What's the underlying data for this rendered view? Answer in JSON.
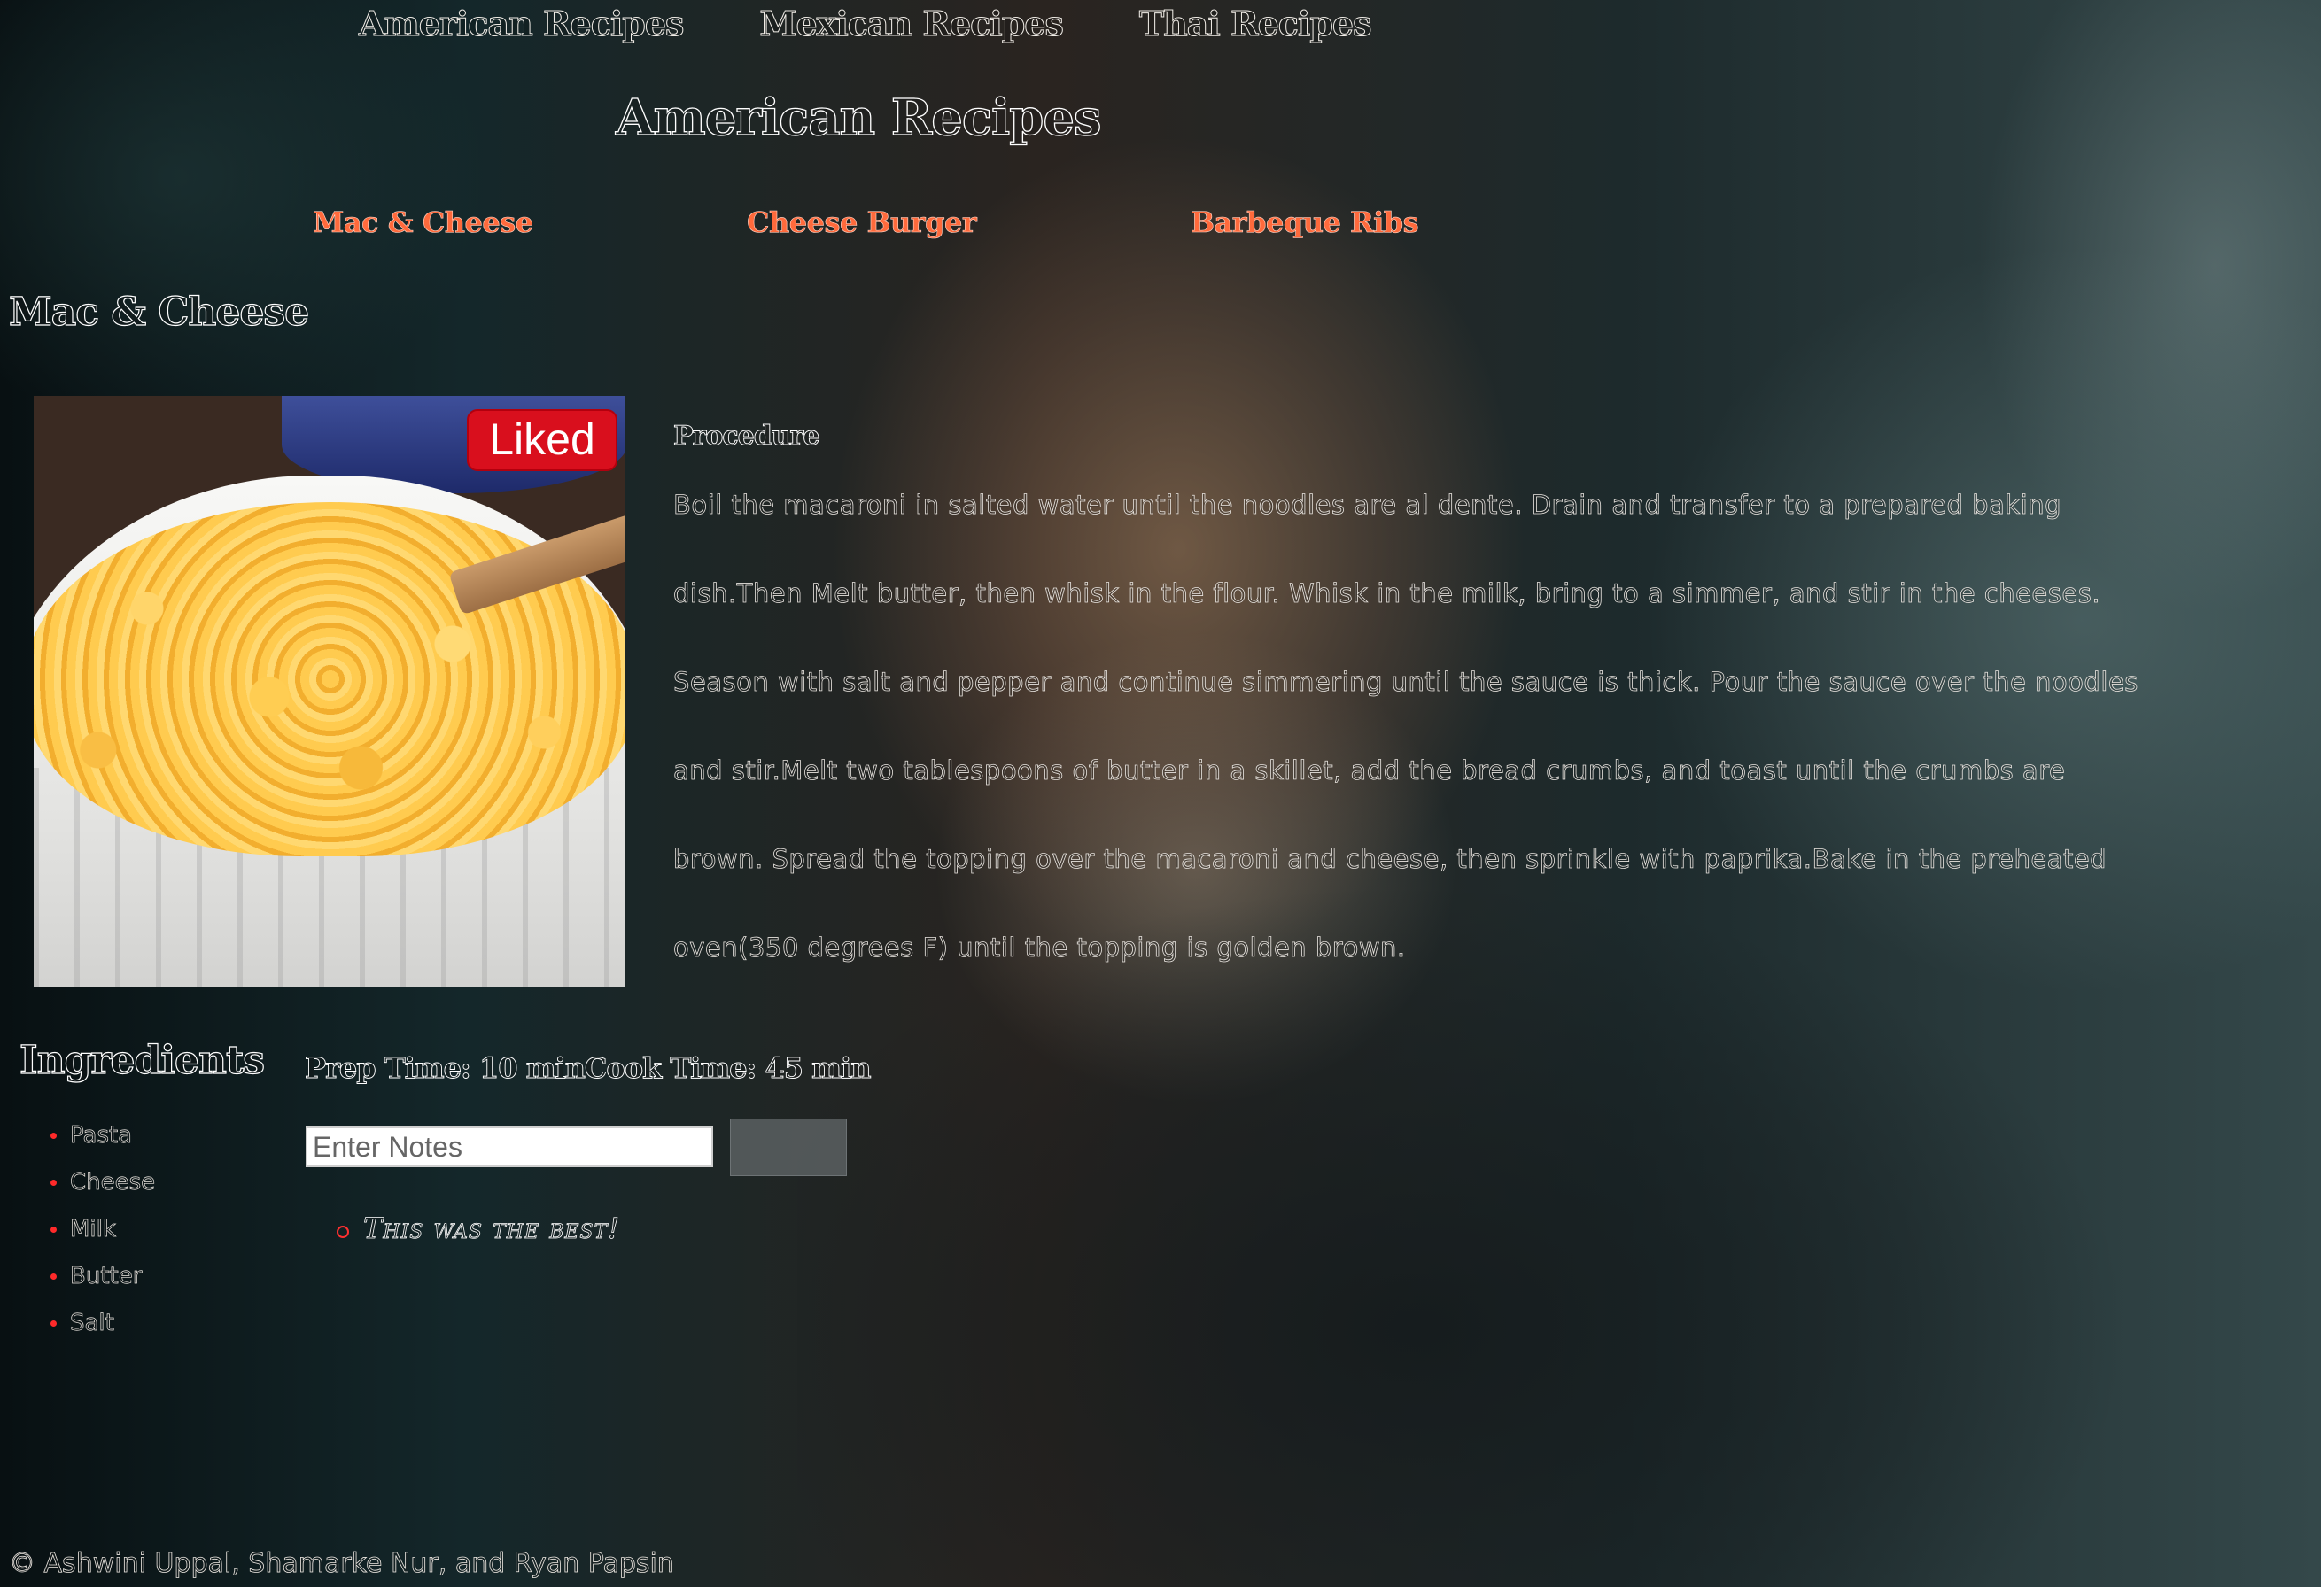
{
  "nav": {
    "items": [
      "American Recipes",
      "Mexican Recipes",
      "Thai Recipes"
    ]
  },
  "page_title": "American Recipes",
  "sub_nav": {
    "items": [
      "Mac & Cheese",
      "Cheese Burger",
      "Barbeque Ribs"
    ],
    "color": "#ff6a3c"
  },
  "recipe": {
    "title": "Mac & Cheese",
    "liked_label": "Liked",
    "procedure_heading": "Procedure",
    "procedure_text": "Boil the macaroni in salted water until the noodles are al dente. Drain and transfer to a prepared baking dish.Then Melt butter, then whisk in the flour. Whisk in the milk, bring to a simmer, and stir in the cheeses. Season with salt and pepper and continue simmering until the sauce is thick. Pour the sauce over the noodles and stir.Melt two tablespoons of butter in a skillet, add the bread crumbs, and toast until the crumbs are brown. Spread the topping over the macaroni and cheese, then sprinkle with paprika.Bake in the preheated oven(350 degrees F) until the topping is golden brown.",
    "times": "Prep Time: 10 minCook Time: 45 min"
  },
  "ingredients": {
    "heading": "Ingredients",
    "items": [
      "Pasta",
      "Cheese",
      "Milk",
      "Butter",
      "Salt"
    ]
  },
  "notes": {
    "placeholder": "Enter Notes",
    "input_value": "",
    "button_label": "",
    "items": [
      "This was the best!"
    ]
  },
  "footer": "© Ashwini Uppal, Shamarke Nur, and Ryan Papsin",
  "colors": {
    "liked_badge": "#d90f1d",
    "bullet": "#ff2a2a"
  }
}
